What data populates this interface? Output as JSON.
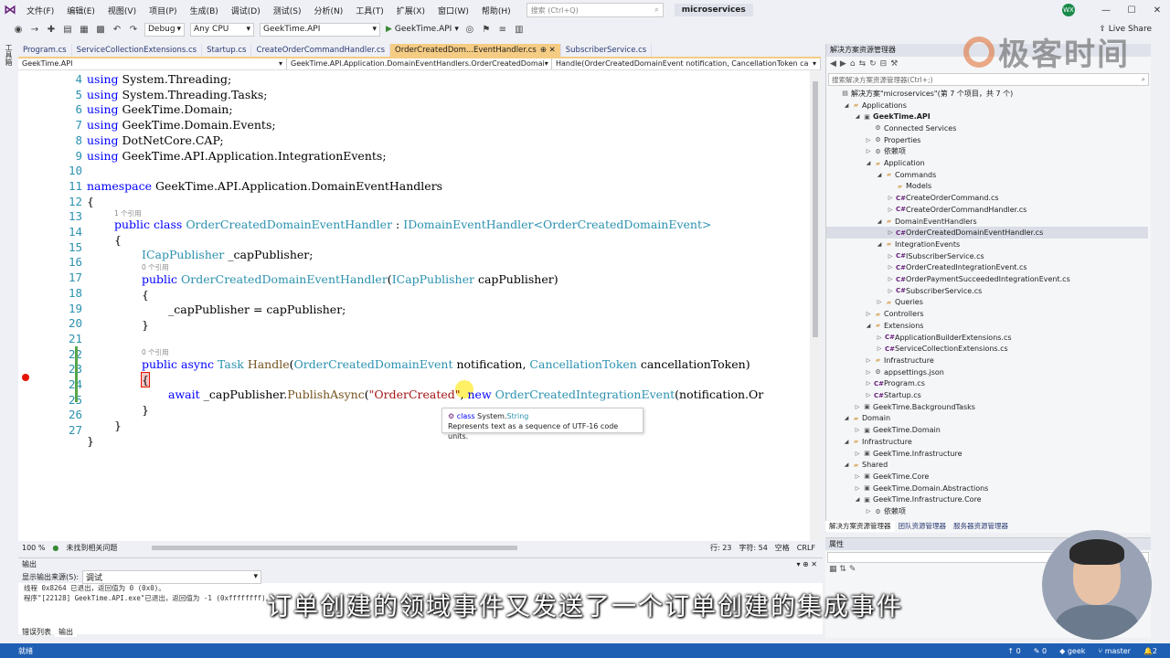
{
  "titlebar": {
    "menu": [
      "文件(F)",
      "编辑(E)",
      "视图(V)",
      "项目(P)",
      "生成(B)",
      "调试(D)",
      "测试(S)",
      "分析(N)",
      "工具(T)",
      "扩展(X)",
      "窗口(W)",
      "帮助(H)"
    ],
    "search_placeholder": "搜索 (Ctrl+Q)",
    "solution_name": "microservices",
    "user_initials": "WX",
    "live_share": "Live Share"
  },
  "toolbar": {
    "config": "Debug",
    "platform": "Any CPU",
    "startup_project": "GeekTime.API",
    "run_target": "GeekTime.API"
  },
  "left_strip_label": "工具箱",
  "doc_tabs": [
    {
      "label": "Program.cs",
      "active": false
    },
    {
      "label": "ServiceCollectionExtensions.cs",
      "active": false
    },
    {
      "label": "Startup.cs",
      "active": false
    },
    {
      "label": "CreateOrderCommandHandler.cs",
      "active": false
    },
    {
      "label": "OrderCreatedDom...EventHandler.cs",
      "active": true,
      "suffix": "⊕ ✕"
    },
    {
      "label": "SubscriberService.cs",
      "active": false
    }
  ],
  "navbar": {
    "project": "GeekTime.API",
    "type": "GeekTime.API.Application.DomainEventHandlers.OrderCreatedDomai",
    "member": "Handle(OrderCreatedDomainEvent notification, CancellationToken ca"
  },
  "code": {
    "line_numbers": [
      "4",
      "5",
      "6",
      "7",
      "8",
      "9",
      "10",
      "11",
      "12",
      "13",
      "14",
      "15",
      "16",
      "17",
      "18",
      "19",
      "20",
      "21",
      "22",
      "23",
      "24",
      "25",
      "26",
      "27"
    ],
    "lines": {
      "l4": "System.Threading;",
      "l5": "System.Threading.Tasks;",
      "l6": "GeekTime.Domain;",
      "l7": "GeekTime.Domain.Events;",
      "l8": "DotNetCore.CAP;",
      "l9": "GeekTime.API.Application.IntegrationEvents;",
      "using_kw": "using",
      "namespace_kw": "namespace",
      "namespace_name": "GeekTime.API.Application.DomainEventHandlers",
      "open_brace": "{",
      "close_brace": "}",
      "public_kw": "public",
      "class_kw": "class",
      "class_name": "OrderCreatedDomainEventHandler",
      "colon": ":",
      "interface_name": "IDomainEventHandler",
      "generic_lt": "<",
      "generic_arg": "OrderCreatedDomainEvent",
      "generic_gt": ">",
      "field_type": "ICapPublisher",
      "field_name": "_capPublisher;",
      "ctor_name": "OrderCreatedDomainEventHandler",
      "ctor_param_type": "ICapPublisher",
      "ctor_param": "capPublisher)",
      "paren_open": "(",
      "assign": "_capPublisher = capPublisher;",
      "async_kw": "async",
      "task_type": "Task",
      "method_name": "Handle",
      "param1_type": "OrderCreatedDomainEvent",
      "param1": "notification,",
      "param2_type": "CancellationToken",
      "param2": "cancellationToken)",
      "await_kw": "await",
      "await_target": "_capPublisher.",
      "publish_method": "PublishAsync",
      "event_string": "\"OrderCreated\"",
      "comma": ",",
      "new_kw": "new",
      "integration_type": "OrderCreatedIntegrationEvent",
      "tail": "(notification.Or"
    },
    "codelens": {
      "class_refs": "1 个引用",
      "ctor_refs": "0 个引用",
      "method_refs": "0 个引用"
    }
  },
  "tooltip": {
    "kind": "class",
    "type": "System.",
    "type_name": "String",
    "description": "Represents text as a sequence of UTF-16 code units."
  },
  "editor_status": {
    "zoom": "100 %",
    "issues": "未找到相关问题",
    "line": "行: 23",
    "col": "字符: 54",
    "ws": "空格",
    "eol": "CRLF"
  },
  "output": {
    "title": "输出",
    "source_label": "显示输出来源(S):",
    "source_value": "调试",
    "lines": [
      "线程 0x8264 已退出，返回值为 0 (0x0)。",
      "程序\"[22128] GeekTime.API.exe\"已退出，返回值为 -1 (0xffffffff)。"
    ],
    "tabs": [
      "错误列表",
      "输出"
    ]
  },
  "subtitle": "订单创建的领域事件又发送了一个订单创建的集成事件",
  "statusbar": {
    "left": "就绪",
    "errors": "0",
    "warnings": "0",
    "branch_user": "geek",
    "branch": "master",
    "notif": "2"
  },
  "solution_explorer": {
    "title": "解决方案资源管理器",
    "search_placeholder": "搜索解决方案资源管理器(Ctrl+;)",
    "rows": [
      {
        "label": "解决方案\"microservices\"(第 7 个项目，共 7 个)",
        "indent": 0,
        "icon": "sol",
        "exp": ""
      },
      {
        "label": "Applications",
        "indent": 1,
        "icon": "folder",
        "exp": "◢"
      },
      {
        "label": "GeekTime.API",
        "indent": 2,
        "icon": "proj",
        "exp": "◢",
        "bold": true
      },
      {
        "label": "Connected Services",
        "indent": 3,
        "icon": "gear",
        "exp": ""
      },
      {
        "label": "Properties",
        "indent": 3,
        "icon": "gear",
        "exp": "▷"
      },
      {
        "label": "依赖项",
        "indent": 3,
        "icon": "gear",
        "exp": "▷"
      },
      {
        "label": "Application",
        "indent": 3,
        "icon": "folder",
        "exp": "◢"
      },
      {
        "label": "Commands",
        "indent": 4,
        "icon": "folder",
        "exp": "◢"
      },
      {
        "label": "Models",
        "indent": 5,
        "icon": "folder",
        "exp": ""
      },
      {
        "label": "CreateOrderCommand.cs",
        "indent": 5,
        "icon": "cs",
        "exp": "▷"
      },
      {
        "label": "CreateOrderCommandHandler.cs",
        "indent": 5,
        "icon": "cs",
        "exp": "▷"
      },
      {
        "label": "DomainEventHandlers",
        "indent": 4,
        "icon": "folder",
        "exp": "◢"
      },
      {
        "label": "OrderCreatedDomainEventHandler.cs",
        "indent": 5,
        "icon": "cs",
        "exp": "▷",
        "selected": true
      },
      {
        "label": "IntegrationEvents",
        "indent": 4,
        "icon": "folder",
        "exp": "◢"
      },
      {
        "label": "ISubscriberService.cs",
        "indent": 5,
        "icon": "cs",
        "exp": "▷"
      },
      {
        "label": "OrderCreatedIntegrationEvent.cs",
        "indent": 5,
        "icon": "cs",
        "exp": "▷"
      },
      {
        "label": "OrderPaymentSucceededIntegrationEvent.cs",
        "indent": 5,
        "icon": "cs",
        "exp": "▷"
      },
      {
        "label": "SubscriberService.cs",
        "indent": 5,
        "icon": "cs",
        "exp": "▷"
      },
      {
        "label": "Queries",
        "indent": 4,
        "icon": "folder",
        "exp": "▷"
      },
      {
        "label": "Controllers",
        "indent": 3,
        "icon": "folder",
        "exp": "▷"
      },
      {
        "label": "Extensions",
        "indent": 3,
        "icon": "folder",
        "exp": "◢"
      },
      {
        "label": "ApplicationBuilderExtensions.cs",
        "indent": 4,
        "icon": "cs",
        "exp": "▷"
      },
      {
        "label": "ServiceCollectionExtensions.cs",
        "indent": 4,
        "icon": "cs",
        "exp": "▷"
      },
      {
        "label": "Infrastructure",
        "indent": 3,
        "icon": "folder",
        "exp": "▷"
      },
      {
        "label": "appsettings.json",
        "indent": 3,
        "icon": "gear",
        "exp": "▷"
      },
      {
        "label": "Program.cs",
        "indent": 3,
        "icon": "cs",
        "exp": "▷"
      },
      {
        "label": "Startup.cs",
        "indent": 3,
        "icon": "cs",
        "exp": "▷"
      },
      {
        "label": "GeekTime.BackgroundTasks",
        "indent": 2,
        "icon": "proj",
        "exp": "▷"
      },
      {
        "label": "Domain",
        "indent": 1,
        "icon": "folder",
        "exp": "◢"
      },
      {
        "label": "GeekTime.Domain",
        "indent": 2,
        "icon": "proj",
        "exp": "▷"
      },
      {
        "label": "Infrastructure",
        "indent": 1,
        "icon": "folder",
        "exp": "◢"
      },
      {
        "label": "GeekTime.Infrastructure",
        "indent": 2,
        "icon": "proj",
        "exp": "▷"
      },
      {
        "label": "Shared",
        "indent": 1,
        "icon": "folder",
        "exp": "◢"
      },
      {
        "label": "GeekTime.Core",
        "indent": 2,
        "icon": "proj",
        "exp": "▷"
      },
      {
        "label": "GeekTime.Domain.Abstractions",
        "indent": 2,
        "icon": "proj",
        "exp": "▷"
      },
      {
        "label": "GeekTime.Infrastructure.Core",
        "indent": 2,
        "icon": "proj",
        "exp": "◢"
      },
      {
        "label": "依赖项",
        "indent": 3,
        "icon": "gear",
        "exp": "▷"
      }
    ],
    "tabs": [
      "解决方案资源管理器",
      "团队资源管理器",
      "服务器资源管理器"
    ]
  },
  "properties": {
    "title": "属性"
  },
  "watermark": "极客时间",
  "colors": {
    "accent_tab": "#f5cc84",
    "statusbar": "#1f5fb3",
    "keyword": "#0000ff",
    "type": "#2b91af",
    "string": "#a31515"
  }
}
